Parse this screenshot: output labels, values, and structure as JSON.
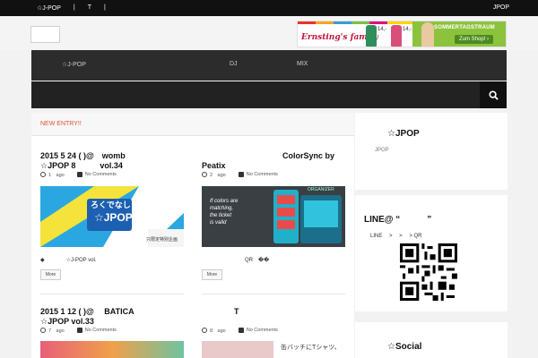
{
  "topbar": {
    "left_items": [
      "☆J-POP",
      "|",
      "T",
      "|"
    ],
    "right_item": "JPOP"
  },
  "banner": {
    "brand": "Ernsting's family",
    "prices": [
      "14,-",
      "14,-",
      "14,-"
    ],
    "promo": "SOMMERTAGSTRAUM",
    "shop_button": "Zum Shop! ›",
    "colors": {
      "green": "#8cc33d",
      "red": "#c0143c"
    }
  },
  "nav": {
    "items": [
      "☆J-POP",
      "DJ",
      "MIX"
    ]
  },
  "main": {
    "section_label": "NEW ENTRY!!",
    "posts": [
      {
        "title_line1": "2015 5 24 ( )@　womb",
        "title_line2": "☆JPOP 8　　　vol.34",
        "meta_date": "1　ago",
        "meta_comments": "No Comments",
        "thumb_text1": "ろくでなし",
        "thumb_text2": "☆JPOP",
        "thumb_sub": "只限定特別企画",
        "excerpt": "◆　　　　☆J-POP vol.",
        "more": "More"
      },
      {
        "title_line1": "　　　　　　　　　　ColorSync by",
        "title_line2": "Peatix",
        "meta_date": "2　ago",
        "meta_comments": "No Comments",
        "thumb_text1": "If colors are",
        "thumb_text2": "matching,",
        "thumb_text3": "the ticket",
        "thumb_text4": "is valid",
        "thumb_badge": "ORGANIZER",
        "excerpt": "　　　　　　　　QR　��",
        "more": "More"
      },
      {
        "title_line1": "2015 1 12 ( )@　 BATICA",
        "title_line2": "☆JPOP vol.33",
        "meta_date": "7　ago",
        "meta_comments": "No Comments"
      },
      {
        "title_line1": "　　　　T",
        "meta_date": "8　ago",
        "meta_comments": "No Comments",
        "thumb_text": "缶バッチにTシャツ、"
      }
    ]
  },
  "sidebar": {
    "jpop_title": "☆JPOP",
    "jpop_sub": "JPOP",
    "line_title": "LINE@ “　　　”",
    "line_sub": "LINE　 >　 >　 > QR",
    "social_title": "☆Social"
  }
}
